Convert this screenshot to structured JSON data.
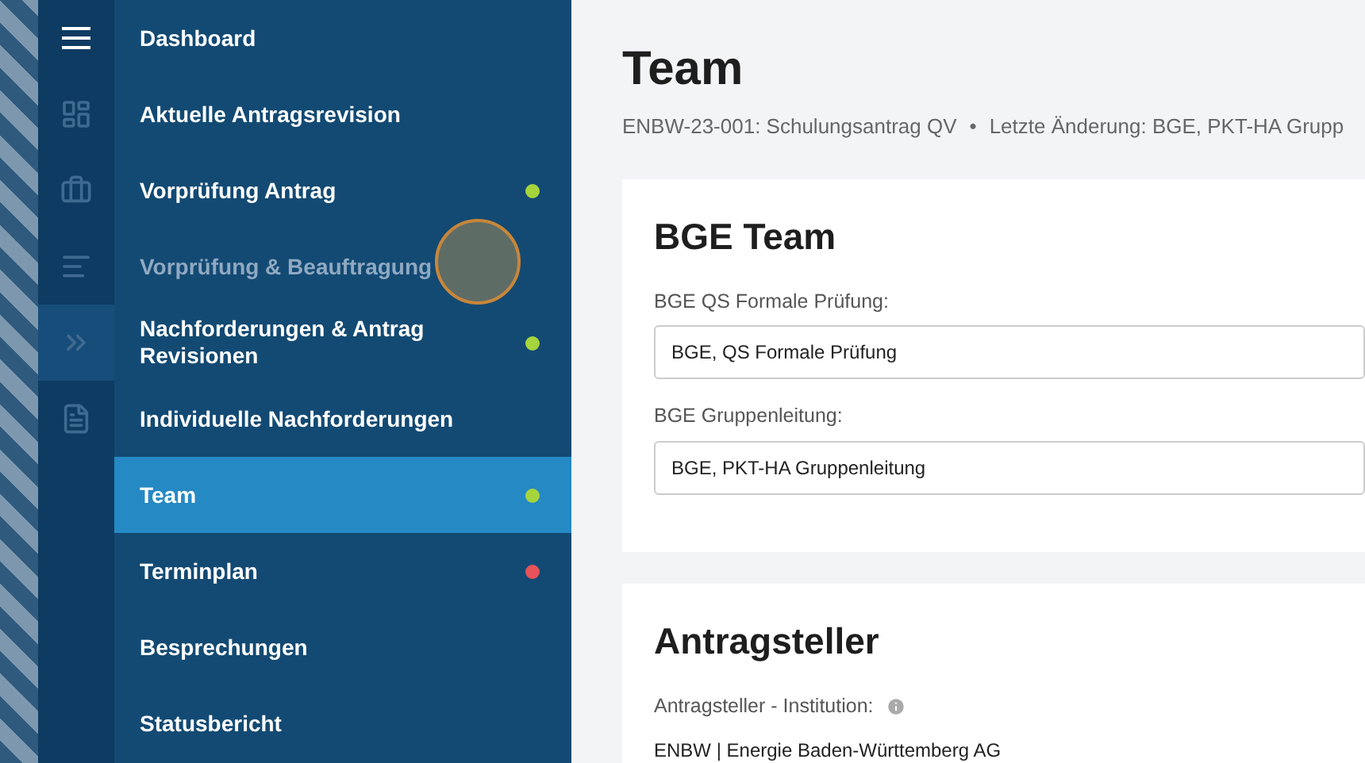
{
  "rail_items": [
    {
      "selected": false
    },
    {
      "selected": false
    },
    {
      "selected": false
    },
    {
      "selected": true
    },
    {
      "selected": false
    }
  ],
  "nav": [
    {
      "label": "Dashboard",
      "selected": false,
      "disabled": false
    },
    {
      "label": "Aktuelle Antragsrevision",
      "selected": false,
      "disabled": false
    },
    {
      "label": "Vorprüfung Antrag",
      "selected": false,
      "disabled": false,
      "color": "#a6d43c"
    },
    {
      "label": "Vorprüfung & Beauftragung",
      "selected": false,
      "disabled": true
    },
    {
      "label": "Nachforderungen & Antrag Revisionen",
      "selected": false,
      "disabled": false,
      "color": "#a6d43c"
    },
    {
      "label": "Individuelle Nachforderungen",
      "selected": false,
      "disabled": false
    },
    {
      "label": "Team",
      "selected": true,
      "disabled": false,
      "color": "#a6d43c"
    },
    {
      "label": "Terminplan",
      "selected": false,
      "disabled": false,
      "color": "#e8525a"
    },
    {
      "label": "Besprechungen",
      "selected": false,
      "disabled": false
    },
    {
      "label": "Statusbericht",
      "selected": false,
      "disabled": false
    }
  ],
  "page": {
    "title": "Team",
    "subtitle": "ENBW-23-001: Schulungsantrag QV",
    "separator": "•",
    "last_change": "Letzte Änderung: BGE, PKT-HA Grupp"
  },
  "cards": [
    {
      "title": "BGE Team",
      "fields": [
        {
          "kind": "input",
          "label": "BGE QS Formale Prüfung:",
          "value": "BGE, QS Formale Prüfung"
        },
        {
          "kind": "input",
          "label": "BGE Gruppenleitung:",
          "value": "BGE, PKT-HA Gruppenleitung"
        }
      ]
    },
    {
      "title": "Antragsteller",
      "fields": [
        {
          "kind": "text",
          "label": "Antragsteller - Institution:",
          "info": true,
          "value": "ENBW | Energie Baden-Württemberg AG"
        }
      ]
    }
  ]
}
